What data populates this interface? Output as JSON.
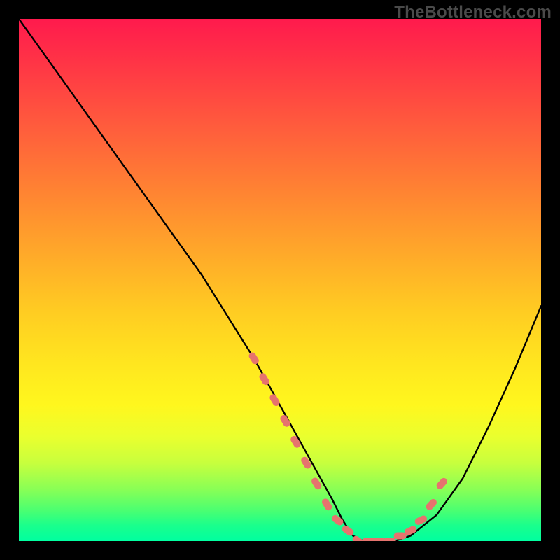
{
  "watermark": "TheBottleneck.com",
  "chart_data": {
    "type": "line",
    "title": "",
    "xlabel": "",
    "ylabel": "",
    "xlim": [
      0,
      100
    ],
    "ylim": [
      0,
      100
    ],
    "series": [
      {
        "name": "bottleneck-curve",
        "x": [
          0,
          5,
          10,
          15,
          20,
          25,
          30,
          35,
          40,
          45,
          50,
          55,
          60,
          62,
          64,
          66,
          68,
          70,
          72,
          75,
          80,
          85,
          90,
          95,
          100
        ],
        "y": [
          100,
          93,
          86,
          79,
          72,
          65,
          58,
          51,
          43,
          35,
          26,
          17,
          8,
          4,
          1,
          0,
          0,
          0,
          0,
          1,
          5,
          12,
          22,
          33,
          45
        ]
      }
    ],
    "markers": {
      "name": "highlight-dots",
      "color": "#e6736e",
      "points_x": [
        45,
        47,
        49,
        51,
        53,
        55,
        57,
        59,
        61,
        63,
        65,
        67,
        69,
        71,
        73,
        75,
        77,
        79,
        81
      ],
      "points_y": [
        35,
        31,
        27,
        23,
        19,
        15,
        11,
        7,
        4,
        2,
        0,
        0,
        0,
        0,
        1,
        2,
        4,
        7,
        11
      ]
    },
    "gradient_stops": [
      {
        "pos": 0,
        "color": "#ff1a4d"
      },
      {
        "pos": 50,
        "color": "#ffcc22"
      },
      {
        "pos": 80,
        "color": "#eaff2e"
      },
      {
        "pos": 100,
        "color": "#00ffa0"
      }
    ]
  }
}
